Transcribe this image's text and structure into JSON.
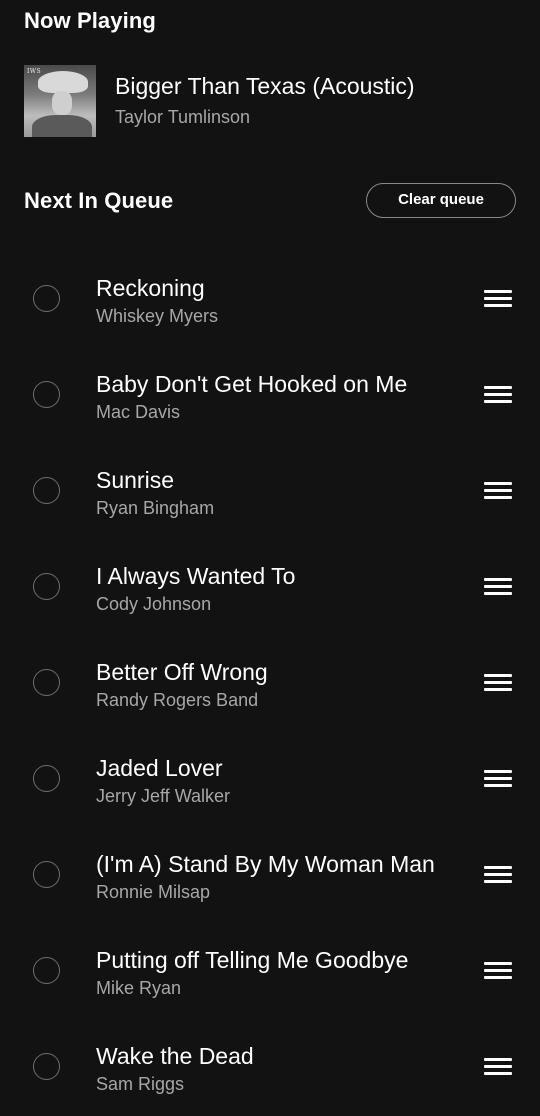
{
  "now_playing": {
    "heading": "Now Playing",
    "album_art_text": "IWS",
    "title": "Bigger Than Texas (Acoustic)",
    "artist": "Taylor Tumlinson"
  },
  "queue": {
    "heading": "Next In Queue",
    "clear_label": "Clear queue",
    "tracks": [
      {
        "title": "Reckoning",
        "artist": "Whiskey Myers"
      },
      {
        "title": "Baby Don't Get Hooked on Me",
        "artist": "Mac Davis"
      },
      {
        "title": "Sunrise",
        "artist": "Ryan Bingham"
      },
      {
        "title": "I Always Wanted To",
        "artist": "Cody Johnson"
      },
      {
        "title": "Better Off Wrong",
        "artist": "Randy Rogers Band"
      },
      {
        "title": "Jaded Lover",
        "artist": "Jerry Jeff Walker"
      },
      {
        "title": "(I'm A) Stand By My Woman Man",
        "artist": "Ronnie Milsap"
      },
      {
        "title": "Putting off Telling Me Goodbye",
        "artist": "Mike Ryan"
      },
      {
        "title": "Wake the Dead",
        "artist": "Sam Riggs"
      }
    ]
  },
  "icons": {
    "select": "circle-outline-icon",
    "reorder": "drag-handle-icon"
  },
  "colors": {
    "background": "#121212",
    "primary_text": "#ffffff",
    "secondary_text": "#a7a7a7"
  }
}
